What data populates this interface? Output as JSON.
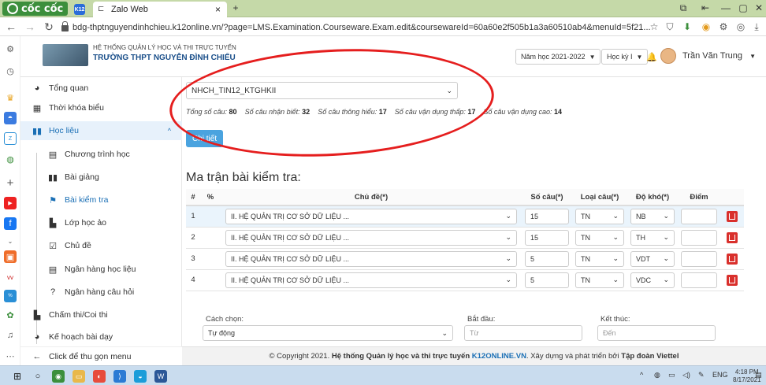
{
  "browser": {
    "brand": "cốc cốc",
    "tab_label": "Zalo Web",
    "url": "bdg-thptnguyendinhchieu.k12online.vn/?page=LMS.Examination.Courseware.Exam.edit&coursewareId=60a60e2f505b1a3a60510ab4&menuId=5f21..."
  },
  "header": {
    "line1": "HỆ THỐNG QUẢN LÝ HỌC VÀ THI TRỰC TUYẾN",
    "line2": "TRƯỜNG THPT NGUYỄN ĐÌNH CHIỂU",
    "year": "Năm học 2021-2022",
    "term": "Học kỳ I",
    "user": "Trần Văn Trung"
  },
  "menu": {
    "items": [
      {
        "label": "Tổng quan"
      },
      {
        "label": "Thời khóa biểu"
      },
      {
        "label": "Học liệu"
      },
      {
        "label": "Chương trình học"
      },
      {
        "label": "Bài giảng"
      },
      {
        "label": "Bài kiểm tra"
      },
      {
        "label": "Lớp học ảo"
      },
      {
        "label": "Chủ đề"
      },
      {
        "label": "Ngân hàng học liệu"
      },
      {
        "label": "Ngân hàng câu hỏi"
      },
      {
        "label": "Chấm thi/Coi thi"
      },
      {
        "label": "Kế hoạch bài dạy"
      },
      {
        "label": "Click để thu gọn menu"
      }
    ]
  },
  "main": {
    "bank_select": "NHCH_TIN12_KTGHKII",
    "stats": {
      "total_label": "Tổng số câu:",
      "total": "80",
      "nb_label": "Số câu nhận biết:",
      "nb": "32",
      "th_label": "Số câu thông hiểu:",
      "th": "17",
      "vdt_label": "Số câu vận dụng thấp:",
      "vdt": "17",
      "vdc_label": "Số câu vận dụng cao:",
      "vdc": "14"
    },
    "detail_button": "Chi tiết",
    "heading": "Ma trận bài kiểm tra:",
    "columns": [
      "#",
      "%",
      "Chủ đề(*)",
      "Số câu(*)",
      "Loại câu(*)",
      "Độ khó(*)",
      "Điểm"
    ],
    "rows": [
      {
        "n": "1",
        "topic": "II. HỆ QUẢN TRỊ CƠ SỞ DỮ LIỆU ...",
        "count": "15",
        "type": "TN",
        "level": "NB"
      },
      {
        "n": "2",
        "topic": "II. HỆ QUẢN TRỊ CƠ SỞ DỮ LIỆU ...",
        "count": "15",
        "type": "TN",
        "level": "TH"
      },
      {
        "n": "3",
        "topic": "II. HỆ QUẢN TRỊ CƠ SỞ DỮ LIỆU ...",
        "count": "5",
        "type": "TN",
        "level": "VDT"
      },
      {
        "n": "4",
        "topic": "II. HỆ QUẢN TRỊ CƠ SỞ DỮ LIỆU ...",
        "count": "5",
        "type": "TN",
        "level": "VDC"
      }
    ],
    "method_label": "Cách chọn:",
    "method_value": "Tự động",
    "start_label": "Bắt đầu:",
    "start_placeholder": "Từ",
    "end_label": "Kết thúc:",
    "end_placeholder": "Đến"
  },
  "footer": {
    "pre": "© Copyright 2021.",
    "system": "Hệ thống Quản lý học và thi trực tuyến",
    "domain": "K12ONLINE.VN",
    "mid": ". Xây dựng và phát triển bởi",
    "company": "Tập đoàn Viettel"
  },
  "taskbar": {
    "lang": "ENG",
    "time": "4:18 PM",
    "date": "8/17/2021"
  }
}
